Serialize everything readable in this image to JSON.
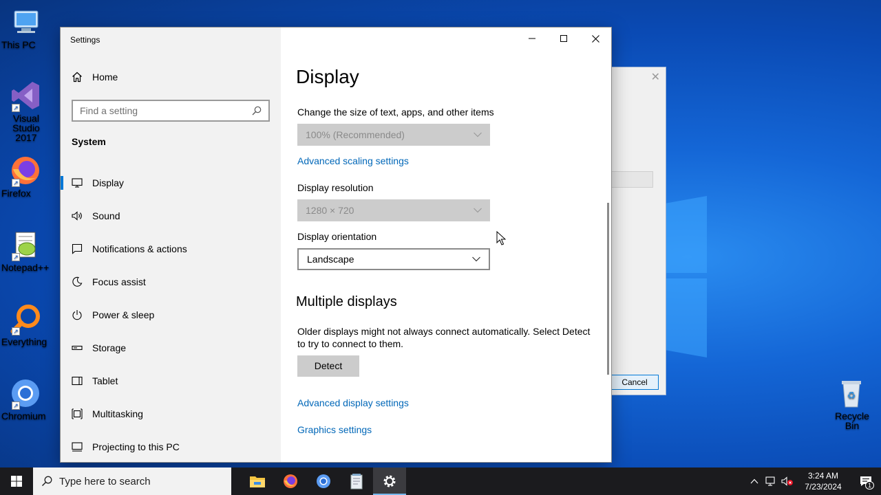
{
  "desktop": {
    "icons": [
      {
        "label": "This PC",
        "icon": "this-pc-icon"
      },
      {
        "label": "Visual Studio 2017",
        "icon": "visual-studio-icon"
      },
      {
        "label": "Firefox",
        "icon": "firefox-icon"
      },
      {
        "label": "Notepad++",
        "icon": "notepadpp-icon"
      },
      {
        "label": "Everything",
        "icon": "everything-icon"
      },
      {
        "label": "Chromium",
        "icon": "chromium-icon"
      },
      {
        "label": "Recycle Bin",
        "icon": "recycle-bin-icon"
      }
    ]
  },
  "background_dialog": {
    "cancel_label": "Cancel"
  },
  "settings": {
    "title": "Settings",
    "home_label": "Home",
    "search_placeholder": "Find a setting",
    "section_label": "System",
    "nav": [
      {
        "label": "Display",
        "icon": "monitor-icon",
        "active": true
      },
      {
        "label": "Sound",
        "icon": "speaker-icon"
      },
      {
        "label": "Notifications & actions",
        "icon": "notification-icon"
      },
      {
        "label": "Focus assist",
        "icon": "moon-icon"
      },
      {
        "label": "Power & sleep",
        "icon": "power-icon"
      },
      {
        "label": "Storage",
        "icon": "storage-icon"
      },
      {
        "label": "Tablet",
        "icon": "tablet-icon"
      },
      {
        "label": "Multitasking",
        "icon": "multitasking-icon"
      },
      {
        "label": "Projecting to this PC",
        "icon": "projecting-icon"
      }
    ],
    "content": {
      "title": "Display",
      "scale_label": "Change the size of text, apps, and other items",
      "scale_value": "100% (Recommended)",
      "advanced_scaling_link": "Advanced scaling settings",
      "resolution_label": "Display resolution",
      "resolution_value": "1280 × 720",
      "orientation_label": "Display orientation",
      "orientation_value": "Landscape",
      "multiple_displays_title": "Multiple displays",
      "multiple_displays_text": "Older displays might not always connect automatically. Select Detect to try to connect to them.",
      "detect_label": "Detect",
      "advanced_display_link": "Advanced display settings",
      "graphics_link": "Graphics settings"
    }
  },
  "taskbar": {
    "search_placeholder": "Type here to search",
    "apps": [
      "file-explorer-icon",
      "firefox-icon",
      "chromium-icon",
      "notepad-icon",
      "settings-gear-icon"
    ],
    "time": "3:24 AM",
    "date": "7/23/2024",
    "notification_count": "1"
  },
  "colors": {
    "accent": "#0078d7",
    "link": "#0067b8",
    "taskbar": "#1b1b1e"
  }
}
